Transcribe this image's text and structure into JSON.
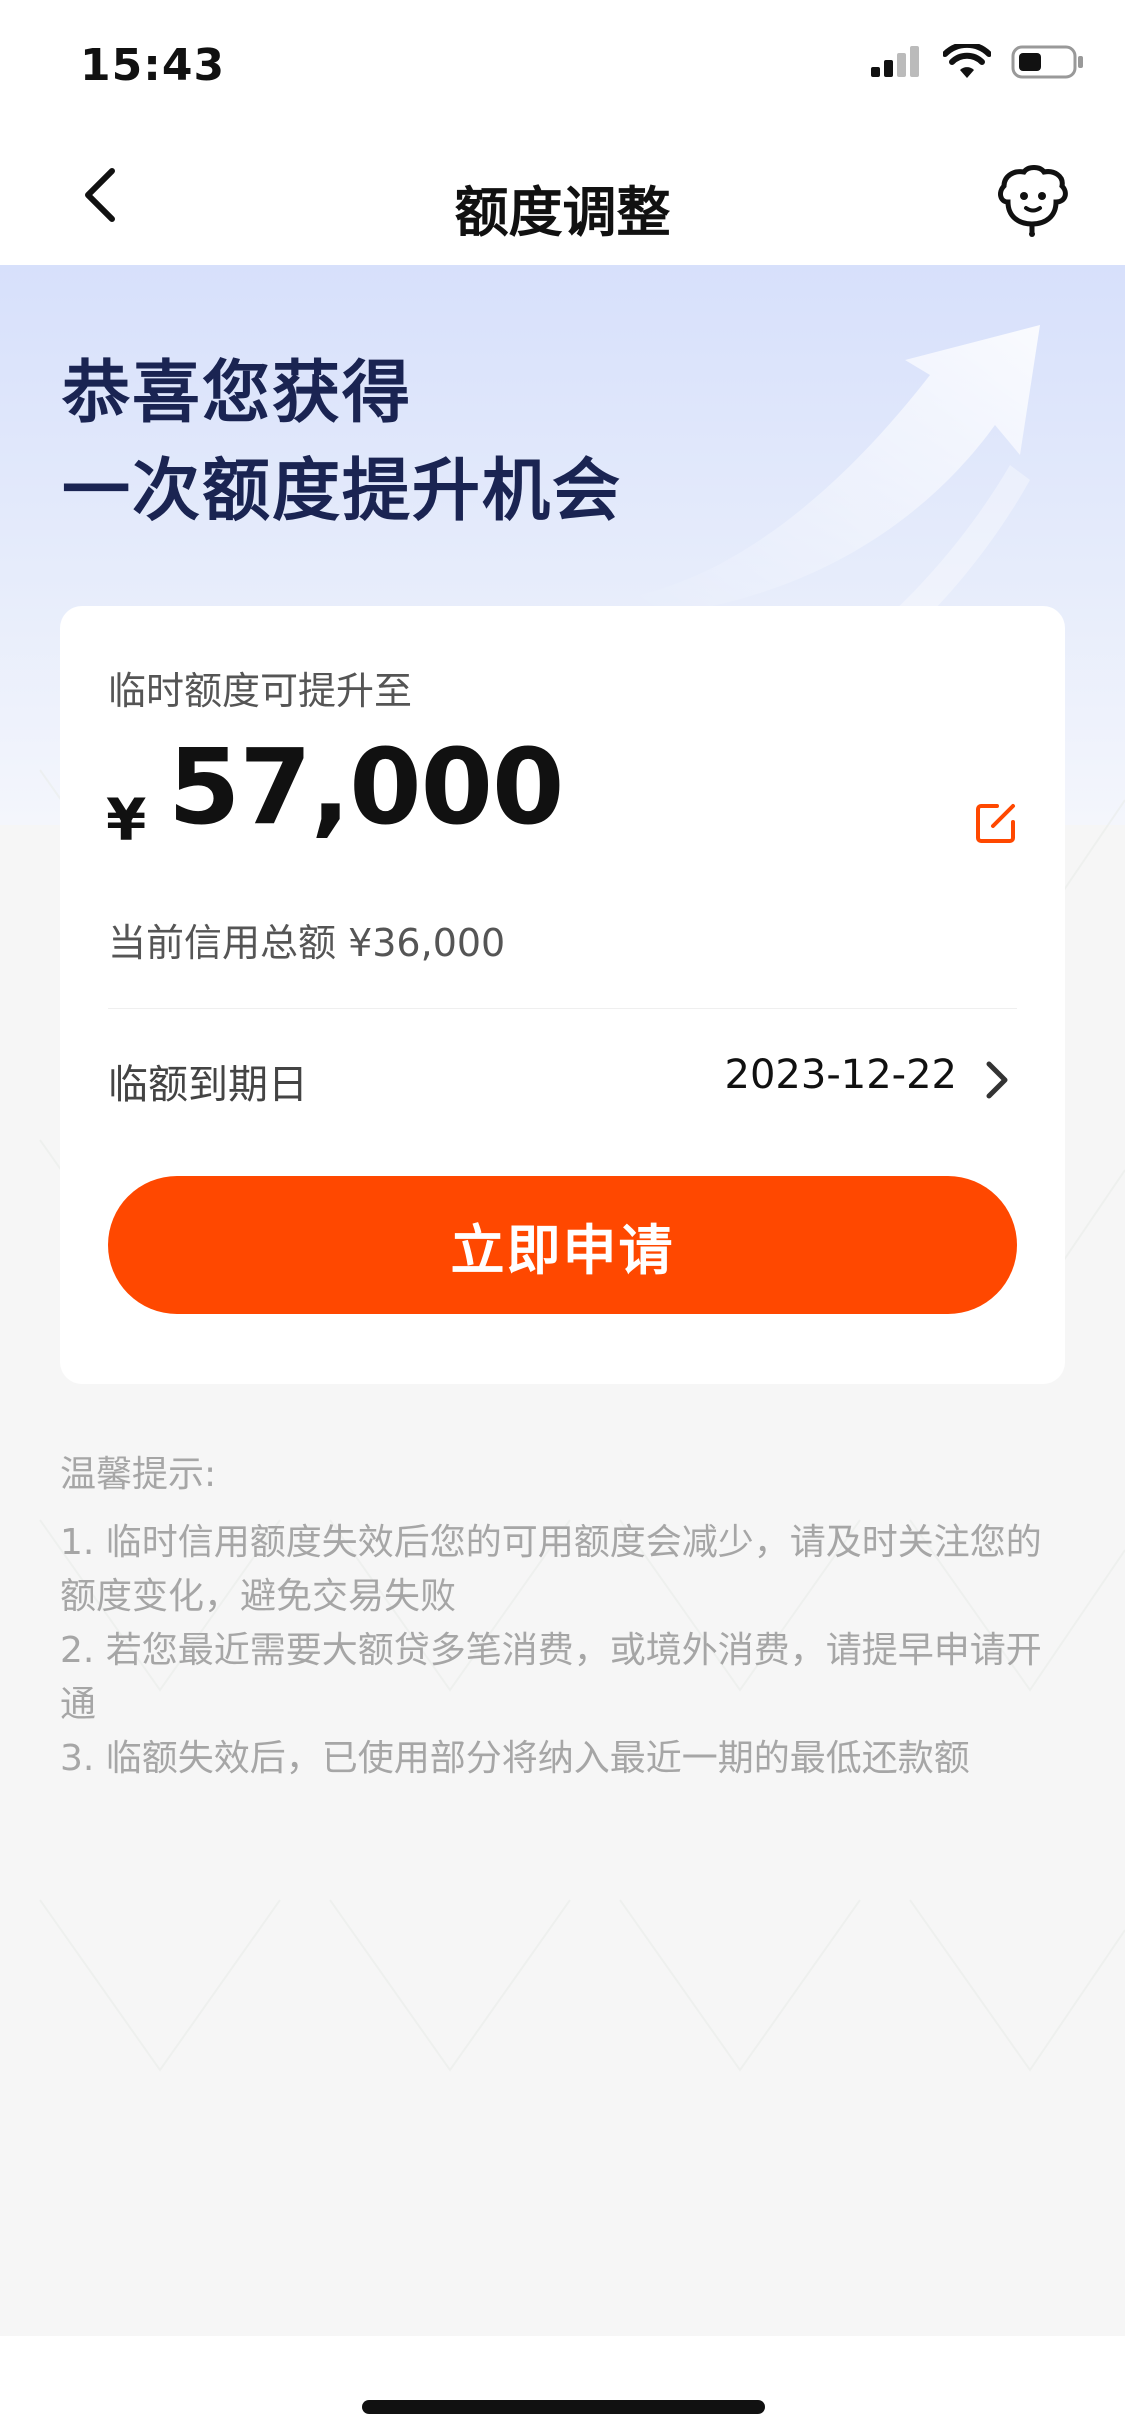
{
  "status_bar": {
    "time": "15:43"
  },
  "nav": {
    "title": "额度调整"
  },
  "hero": {
    "line1": "恭喜您获得",
    "line2": "一次额度提升机会"
  },
  "card": {
    "label": "临时额度可提升至",
    "currency_symbol": "¥",
    "amount": "57,000",
    "total_label": "当前信用总额 ¥36,000",
    "due_label": "临额到期日",
    "due_date": "2023-12-22",
    "apply_label": "立即申请"
  },
  "tips": {
    "title": "温馨提示:",
    "items": [
      "1. 临时信用额度失效后您的可用额度会减少，请及时关注您的额度变化，避免交易失败",
      "2. 若您最近需要大额贷多笔消费，或境外消费，请提早申请开通",
      "3. 临额失效后，已使用部分将纳入最近一期的最低还款额"
    ]
  },
  "colors": {
    "primary": "#ff4800",
    "hero_title": "#1a2452",
    "tip_text": "#a6a6a6"
  },
  "icons": {
    "back": "chevron-left-icon",
    "assistant": "assistant-robot-icon",
    "edit": "edit-icon",
    "chevron": "chevron-right-icon"
  }
}
